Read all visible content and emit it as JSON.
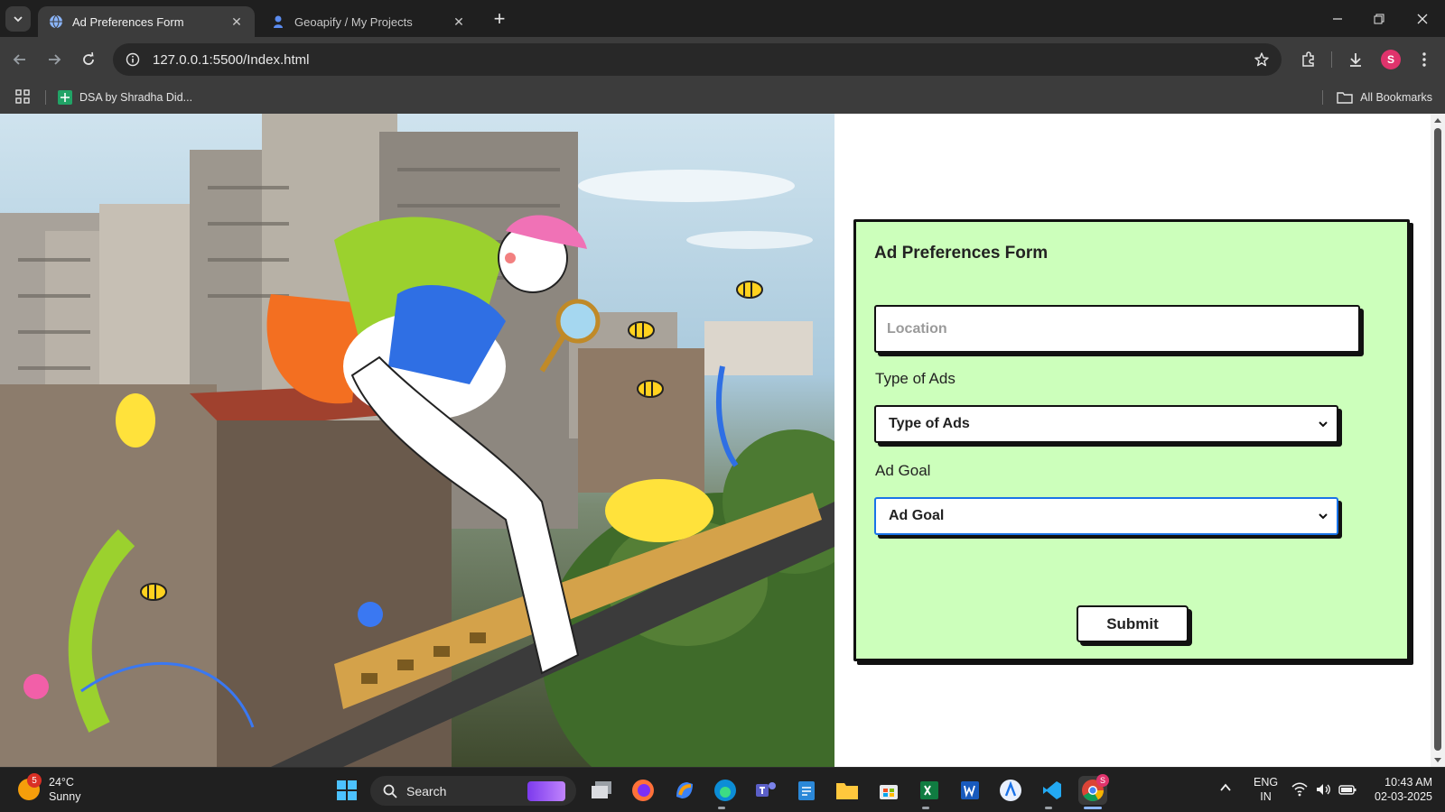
{
  "browser": {
    "tabs": [
      {
        "title": "Ad Preferences Form",
        "active": true
      },
      {
        "title": "Geoapify / My Projects",
        "active": false
      }
    ],
    "url": "127.0.0.1:5500/Index.html",
    "profile_initial": "S",
    "bookmarks": [
      {
        "label": "DSA by Shradha Did..."
      }
    ],
    "all_bookmarks_label": "All Bookmarks"
  },
  "form": {
    "title": "Ad Preferences Form",
    "location_placeholder": "Location",
    "type_label": "Type of Ads",
    "type_value": "Type of Ads",
    "goal_label": "Ad Goal",
    "goal_value": "Ad Goal",
    "submit_label": "Submit"
  },
  "taskbar": {
    "weather_temp": "24°C",
    "weather_desc": "Sunny",
    "weather_badge": "5",
    "search_label": "Search",
    "lang_top": "ENG",
    "lang_bottom": "IN",
    "time": "10:43 AM",
    "date": "02-03-2025",
    "chrome_badge": "S"
  },
  "colors": {
    "form_bg": "#ccffbb",
    "accent_focus": "#1a73e8",
    "profile": "#e0336c"
  }
}
